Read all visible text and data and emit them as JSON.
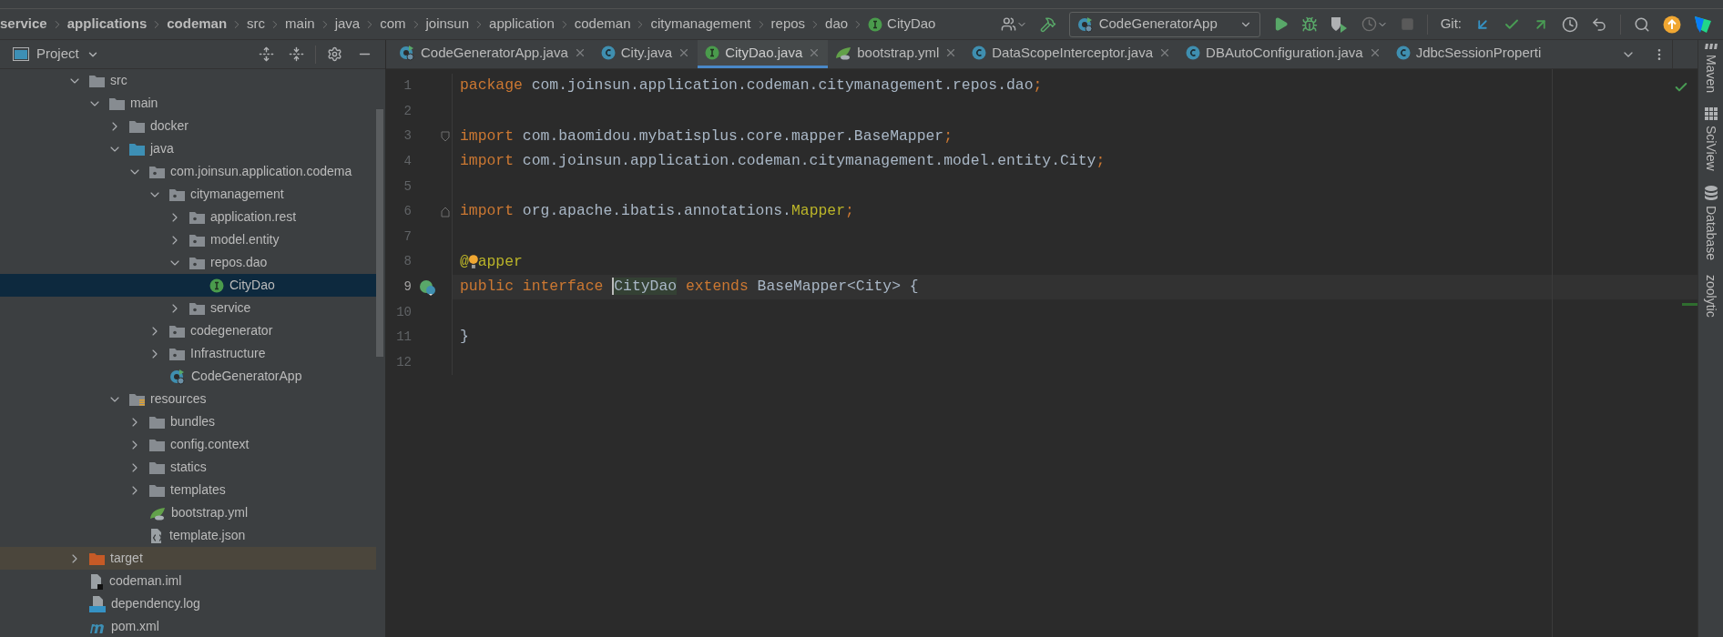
{
  "breadcrumbs": [
    {
      "label": "service",
      "kind": "module"
    },
    {
      "label": "applications",
      "kind": "module"
    },
    {
      "label": "codeman",
      "kind": "module"
    },
    {
      "label": "src",
      "kind": "dir"
    },
    {
      "label": "main",
      "kind": "dir"
    },
    {
      "label": "java",
      "kind": "dir"
    },
    {
      "label": "com",
      "kind": "dir"
    },
    {
      "label": "joinsun",
      "kind": "dir"
    },
    {
      "label": "application",
      "kind": "dir"
    },
    {
      "label": "codeman",
      "kind": "dir"
    },
    {
      "label": "citymanagement",
      "kind": "dir"
    },
    {
      "label": "repos",
      "kind": "dir"
    },
    {
      "label": "dao",
      "kind": "dir"
    },
    {
      "label": "CityDao",
      "kind": "interface"
    }
  ],
  "toolbar": {
    "run_config": "CodeGeneratorApp",
    "git_label": "Git:"
  },
  "project_panel": {
    "title": "Project",
    "tree": [
      {
        "label": "src",
        "kind": "folder",
        "expanded": true,
        "selected": false,
        "children": [
          {
            "label": "main",
            "kind": "folder",
            "expanded": true,
            "selected": false,
            "children": [
              {
                "label": "docker",
                "kind": "folder",
                "expanded": false,
                "selected": false
              },
              {
                "label": "java",
                "kind": "source",
                "expanded": true,
                "selected": false,
                "children": [
                  {
                    "label": "com.joinsun.application.codema",
                    "kind": "package",
                    "expanded": true,
                    "selected": false,
                    "children": [
                      {
                        "label": "citymanagement",
                        "kind": "package",
                        "expanded": true,
                        "selected": false,
                        "children": [
                          {
                            "label": "application.rest",
                            "kind": "package",
                            "expanded": false,
                            "selected": false
                          },
                          {
                            "label": "model.entity",
                            "kind": "package",
                            "expanded": false,
                            "selected": false
                          },
                          {
                            "label": "repos.dao",
                            "kind": "package",
                            "expanded": true,
                            "selected": false,
                            "children": [
                              {
                                "label": "CityDao",
                                "kind": "interface",
                                "selected": true
                              }
                            ]
                          },
                          {
                            "label": "service",
                            "kind": "package",
                            "expanded": false,
                            "selected": false
                          }
                        ]
                      },
                      {
                        "label": "codegenerator",
                        "kind": "package",
                        "expanded": false,
                        "selected": false
                      },
                      {
                        "label": "Infrastructure",
                        "kind": "package",
                        "expanded": false,
                        "selected": false
                      },
                      {
                        "label": "CodeGeneratorApp",
                        "kind": "spring-app",
                        "selected": false
                      }
                    ]
                  }
                ]
              },
              {
                "label": "resources",
                "kind": "resources",
                "expanded": true,
                "selected": false,
                "children": [
                  {
                    "label": "bundles",
                    "kind": "folder",
                    "expanded": false,
                    "selected": false
                  },
                  {
                    "label": "config.context",
                    "kind": "folder",
                    "expanded": false,
                    "selected": false
                  },
                  {
                    "label": "statics",
                    "kind": "folder",
                    "expanded": false,
                    "selected": false
                  },
                  {
                    "label": "templates",
                    "kind": "folder",
                    "expanded": false,
                    "selected": false
                  },
                  {
                    "label": "bootstrap.yml",
                    "kind": "spring-yml",
                    "selected": false
                  },
                  {
                    "label": "template.json",
                    "kind": "json",
                    "selected": false
                  }
                ]
              }
            ]
          }
        ]
      },
      {
        "label": "target",
        "kind": "excluded",
        "expanded": false,
        "selected": false
      },
      {
        "label": "codeman.iml",
        "kind": "iml",
        "selected": false
      },
      {
        "label": "dependency.log",
        "kind": "log",
        "selected": false
      },
      {
        "label": "pom.xml",
        "kind": "maven",
        "selected": false
      }
    ]
  },
  "tabs": [
    {
      "label": "CodeGeneratorApp.java",
      "kind": "spring-app",
      "selected": false,
      "closable": true
    },
    {
      "label": "City.java",
      "kind": "class",
      "selected": false,
      "closable": true
    },
    {
      "label": "CityDao.java",
      "kind": "interface",
      "selected": true,
      "closable": true
    },
    {
      "label": "bootstrap.yml",
      "kind": "spring-yml",
      "selected": false,
      "closable": true
    },
    {
      "label": "DataScopeInterceptor.java",
      "kind": "class",
      "selected": false,
      "closable": true
    },
    {
      "label": "DBAutoConfiguration.java",
      "kind": "class",
      "selected": false,
      "closable": true
    },
    {
      "label": "JdbcSessionProperti",
      "kind": "class",
      "selected": false,
      "closable": false
    }
  ],
  "editor": {
    "lines": [
      {
        "number": "1",
        "current": false,
        "tokens": [
          {
            "text": "package",
            "kind": "keyword"
          },
          {
            "text": " com.joinsun.application.codeman.citymanagement.repos.dao",
            "kind": "plain"
          },
          {
            "text": ";",
            "kind": "punct"
          }
        ]
      },
      {
        "number": "2",
        "current": false
      },
      {
        "number": "3",
        "current": false,
        "marker": {
          "kind": "fold-start"
        },
        "tokens": [
          {
            "text": "import",
            "kind": "keyword"
          },
          {
            "text": " com.baomidou.mybatisplus.core.mapper.BaseMapper",
            "kind": "plain"
          },
          {
            "text": ";",
            "kind": "punct"
          }
        ]
      },
      {
        "number": "4",
        "current": false,
        "tokens": [
          {
            "text": "import",
            "kind": "keyword"
          },
          {
            "text": " com.joinsun.application.codeman.citymanagement.model.entity.City",
            "kind": "plain"
          },
          {
            "text": ";",
            "kind": "punct"
          }
        ]
      },
      {
        "number": "5",
        "current": false
      },
      {
        "number": "6",
        "current": false,
        "marker": {
          "kind": "fold-end"
        },
        "tokens": [
          {
            "text": "import",
            "kind": "keyword"
          },
          {
            "text": " org.apache.ibatis.annotations.",
            "kind": "plain"
          },
          {
            "text": "Mapper",
            "kind": "annotation"
          },
          {
            "text": ";",
            "kind": "punct"
          }
        ]
      },
      {
        "number": "7",
        "current": false
      },
      {
        "number": "8",
        "current": false,
        "tokens": [
          {
            "text": "@",
            "kind": "annotation"
          },
          {
            "kind": "bulb"
          },
          {
            "text": "apper",
            "kind": "annotation"
          }
        ]
      },
      {
        "number": "9",
        "current": true,
        "marker": {
          "kind": "implemented"
        },
        "tokens": [
          {
            "text": "public interface",
            "kind": "keyword"
          },
          {
            "text": "CityDao",
            "kind": "plain",
            "space_before": true,
            "highlight": true,
            "caret": true
          },
          {
            "text": " extends",
            "kind": "keyword"
          },
          {
            "text": " BaseMapper<City> {",
            "kind": "plain"
          }
        ]
      },
      {
        "number": "10",
        "current": false
      },
      {
        "number": "11",
        "current": false,
        "tokens": [
          {
            "text": "}",
            "kind": "plain"
          }
        ]
      },
      {
        "number": "12",
        "current": false
      }
    ]
  },
  "side_tools": [
    {
      "label": "Maven",
      "kind": "maven"
    },
    {
      "label": "SciView",
      "kind": "grid"
    },
    {
      "label": "Database",
      "kind": "database"
    },
    {
      "label": "zoolytic",
      "kind": "plain"
    }
  ]
}
